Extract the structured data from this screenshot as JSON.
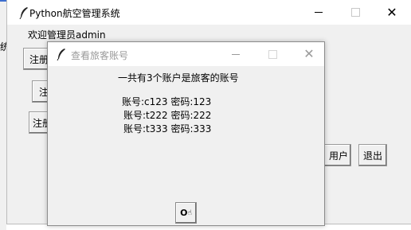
{
  "background": {
    "cut_label": "统"
  },
  "main_window": {
    "title": "Python航空管理系统",
    "welcome": "欢迎管理员admin",
    "buttons": {
      "btn1": "注册",
      "btn2": "注",
      "btn3": "注册",
      "user": "用户",
      "exit": "退出"
    }
  },
  "dialog": {
    "title": "查看旅客账号",
    "summary": "一共有3个账户是旅客的账号",
    "accounts": [
      "账号:c123 密码:123",
      "账号:t222 密码:222",
      "账号:t333 密码:333"
    ],
    "ok_label": "O"
  },
  "colors": {
    "titlebar": "#ffffff",
    "window": "#f0f0f0",
    "inactive_text": "#9a9a9a"
  }
}
